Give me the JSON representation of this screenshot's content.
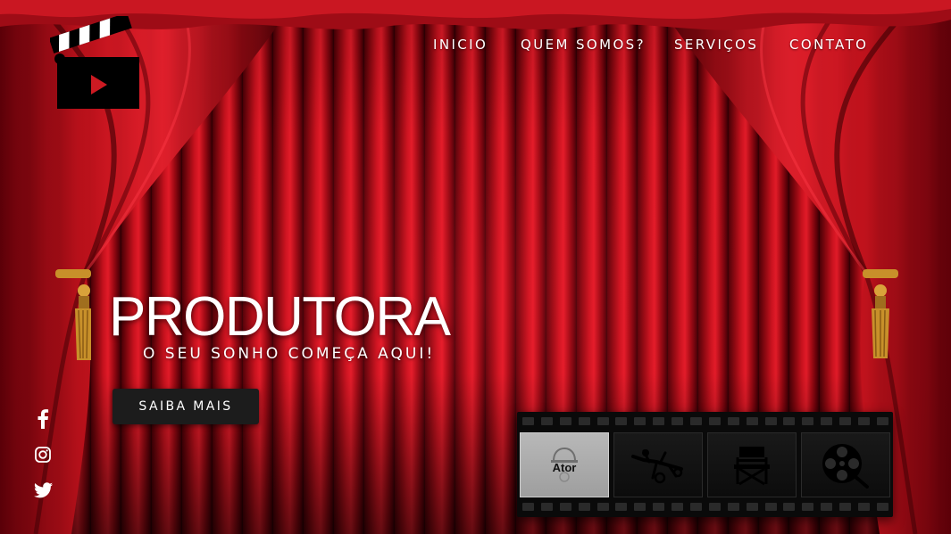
{
  "nav": {
    "items": [
      {
        "label": "INICIO"
      },
      {
        "label": "QUEM SOMOS?"
      },
      {
        "label": "SERVIÇOS"
      },
      {
        "label": "CONTATO"
      }
    ]
  },
  "hero": {
    "title": "PRODUTORA",
    "subtitle": "O SEU SONHO COMEÇA AQUI!",
    "cta_label": "SAIBA MAIS"
  },
  "social": [
    {
      "icon": "facebook-icon"
    },
    {
      "icon": "instagram-icon"
    },
    {
      "icon": "twitter-icon"
    }
  ],
  "filmstrip": {
    "frames": [
      {
        "label": "Ator",
        "icon": "actor-icon",
        "active": true
      },
      {
        "label": "",
        "icon": "stuntman-icon",
        "active": false
      },
      {
        "label": "",
        "icon": "director-chair-icon",
        "active": false
      },
      {
        "label": "",
        "icon": "film-reel-icon",
        "active": false
      }
    ]
  },
  "colors": {
    "curtain": "#c8121e",
    "button": "#1c1c1c",
    "text": "#ffffff",
    "tassel": "#c8902a"
  }
}
